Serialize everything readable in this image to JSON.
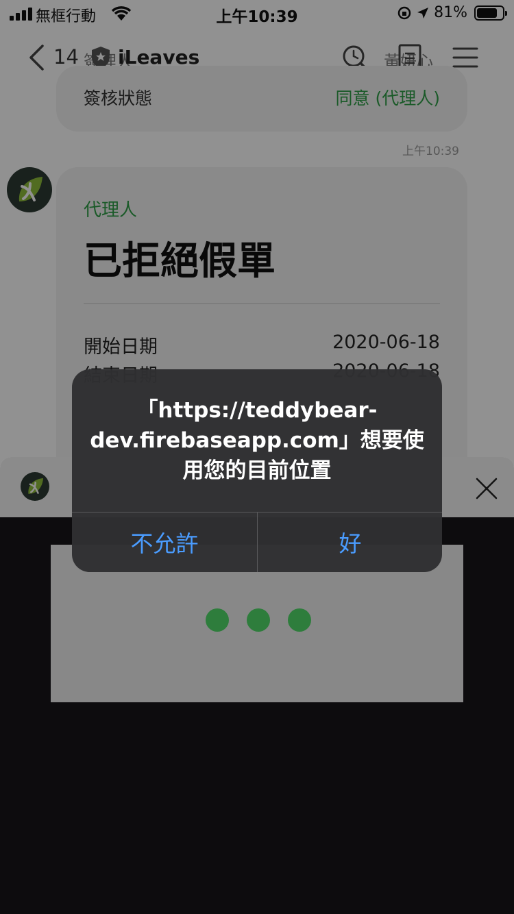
{
  "status_bar": {
    "carrier": "無框行動",
    "time": "上午10:39",
    "battery": "81%",
    "battery_level": 0.81
  },
  "nav": {
    "ghost_left": "簽理人",
    "ghost_right": "黃妍心",
    "back_count": "14",
    "title": "iLeaves",
    "icons": [
      "chevron-left-icon",
      "shield-star-icon",
      "search-icon",
      "document-icon",
      "menu-icon"
    ]
  },
  "chat": {
    "top_card": {
      "key": "簽核狀態",
      "value": "同意 (代理人)"
    },
    "timestamp": "上午10:39",
    "main_card": {
      "sender": "代理人",
      "headline": "已拒絕假單",
      "rows": [
        {
          "key": "開始日期",
          "value": "2020-06-18"
        },
        {
          "key": "結束日期",
          "value": "2020-06-18"
        }
      ]
    }
  },
  "loader": {
    "dot_color": "#2e7d3c",
    "dot_count": 3
  },
  "alert": {
    "message_line1": "「https://teddybear-",
    "message_line2": "dev.firebaseapp.com」想要使",
    "message_line3": "用您的目前位置",
    "deny_label": "不允許",
    "allow_label": "好"
  },
  "colors": {
    "accent_green": "#2f9e47",
    "alert_button_blue": "#4a9cff"
  }
}
